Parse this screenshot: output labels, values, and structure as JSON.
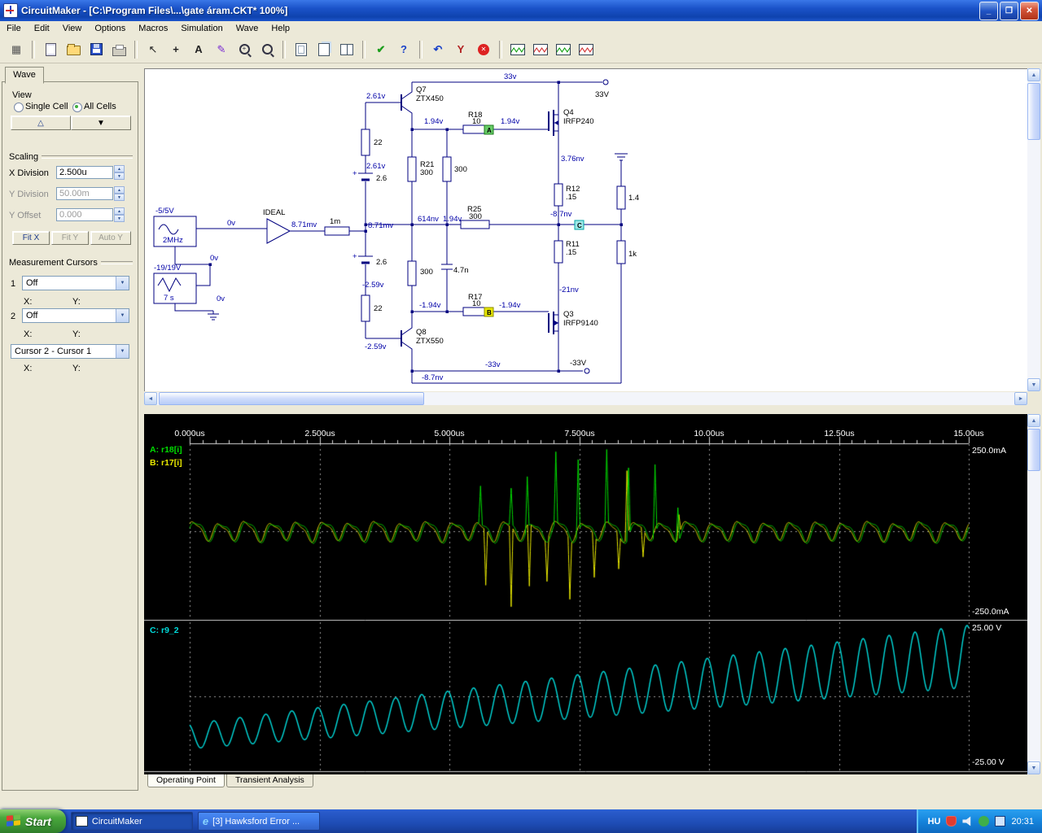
{
  "window": {
    "title": "CircuitMaker - [C:\\Program Files\\...\\gate áram.CKT* 100%]",
    "controls": {
      "minimize": "_",
      "maximize": "❐",
      "close": "✕"
    }
  },
  "menu": [
    "File",
    "Edit",
    "View",
    "Options",
    "Macros",
    "Simulation",
    "Wave",
    "Help"
  ],
  "toolbar": {
    "groups": [
      [
        "parts-browser"
      ],
      [
        "new",
        "open",
        "save",
        "print"
      ],
      [
        "select",
        "wire",
        "text",
        "probe",
        "zoom-area",
        "zoom"
      ],
      [
        "fit-page",
        "multi-page",
        "split-view"
      ],
      [
        "erc-check",
        "help"
      ],
      [
        "undo",
        "probe-y",
        "stop"
      ],
      [
        "scope-1",
        "scope-2",
        "scope-3",
        "scope-4"
      ]
    ]
  },
  "wave_panel": {
    "tab_label": "Wave",
    "view_label": "View",
    "radio_single": "Single Cell",
    "radio_all": "All Cells",
    "up_button": "△",
    "down_button": "▼",
    "scaling_label": "Scaling",
    "x_division_label": "X Division",
    "x_division_value": "2.500u",
    "y_division_label": "Y Division",
    "y_division_value": "50.00m",
    "y_offset_label": "Y Offset",
    "y_offset_value": "0.000",
    "fit_x": "Fit X",
    "fit_y": "Fit Y",
    "auto_y": "Auto Y",
    "cursors_label": "Measurement Cursors",
    "cursor1_num": "1",
    "cursor1_value": "Off",
    "cursor2_num": "2",
    "cursor2_value": "Off",
    "diff_value": "Cursor 2 - Cursor 1",
    "x_label": "X:",
    "y_label": "Y:"
  },
  "circuit": {
    "labels": {
      "rail_top": "33v",
      "term_top": "33V",
      "q7_ref": "Q7",
      "q7_part": "ZTX450",
      "v_q7_base": "2.61v",
      "r22_top": "22",
      "v_bat_top": "2.61v",
      "plus_top": "+",
      "bat_top": "2.6",
      "r21_ref": "R21",
      "r21_val": "300",
      "r300_top": "300",
      "v_r18_l": "1.94v",
      "r18_ref": "R18",
      "r18_val": "10",
      "v_r18_r": "1.94v",
      "probe_a": "A",
      "q4_ref": "Q4",
      "q4_part": "IRFP240",
      "v_q4_s": "3.76nv",
      "r12_ref": "R12",
      "r12_val": ".15",
      "r_load1": "1.4",
      "v_out": "-8.7nv",
      "probe_c": "C",
      "r25_ref": "R25",
      "r25_val": "300",
      "v_614": "614nv",
      "v_mid": "1.94v",
      "r11_ref": "R11",
      "r11_val": ".15",
      "r_load2": "1k",
      "v_q3_s": "-21nv",
      "q3_ref": "Q3",
      "q3_part": "IRFP9140",
      "term_bot": "-33V",
      "rail_bot": "-33v",
      "v_fb": "-8.7nv",
      "q8_ref": "Q8",
      "q8_part": "ZTX550",
      "v_q8_base": "-2.59v",
      "v_bat_bot": "-2.59v",
      "plus_bot": "+",
      "bat_bot": "2.6",
      "r22_bot": "22",
      "r300_bot": "300",
      "c_val": "4.7n",
      "v_r17_l": "-1.94v",
      "r17_ref": "R17",
      "r17_val": "10",
      "v_r17_r": "-1.94v",
      "probe_b": "B",
      "src1_name": "-5/5V",
      "src1_freq": "2MHz",
      "v_in1": "0v",
      "buf_name": "IDEAL",
      "v_buf": "8.71mv",
      "r1m": "1m",
      "v_r1m": "8.71mv",
      "v_in2": "0v",
      "src2_name": "-19/19V",
      "src2_time": "7 s",
      "v_in3": "0v"
    }
  },
  "bottom_tabs": [
    "Operating Point",
    "Transient Analysis"
  ],
  "taskbar": {
    "start_label": "Start",
    "tasks": [
      "CircuitMaker",
      "[3] Hawksford Error ..."
    ],
    "tray_lang": "HU",
    "clock": "20:31"
  },
  "chart_data": [
    {
      "type": "line",
      "x_unit": "us",
      "x_range": [
        0,
        15
      ],
      "x_ticks": [
        "0.000us",
        "2.500us",
        "5.000us",
        "7.500us",
        "10.00us",
        "12.50us",
        "15.00us"
      ],
      "y_range": [
        -250,
        250
      ],
      "y_top_label": "250.0mA",
      "y_bottom_label": "-250.0mA",
      "grid": "dashed",
      "legend_position": "top-left",
      "series": [
        {
          "name": "A: r18[i]",
          "color": "#00dd00",
          "kind": "ripple",
          "amp": 25,
          "period": 0.5,
          "phase": 0,
          "spikes": [
            [
              5.6,
              110
            ],
            [
              6.19,
              105
            ],
            [
              6.5,
              150
            ],
            [
              7.05,
              205
            ],
            [
              7.48,
              210
            ],
            [
              8.03,
              215
            ],
            [
              8.45,
              200
            ],
            [
              8.96,
              200
            ],
            [
              9.4,
              100
            ]
          ]
        },
        {
          "name": "B: r17[i]",
          "color": "#e8e800",
          "kind": "ripple",
          "amp": 24,
          "period": 0.5,
          "phase": 0.5,
          "spikes": [
            [
              5.7,
              -160
            ],
            [
              6.19,
              -230
            ],
            [
              6.54,
              -180
            ],
            [
              6.88,
              -120
            ],
            [
              7.32,
              -170
            ],
            [
              7.79,
              -120
            ],
            [
              8.26,
              -100
            ],
            [
              8.42,
              190
            ],
            [
              8.73,
              -80
            ],
            [
              9.42,
              60
            ]
          ]
        }
      ]
    },
    {
      "type": "line",
      "x_unit": "us",
      "x_range": [
        0,
        15
      ],
      "y_range": [
        -25,
        25
      ],
      "y_top_label": "25.00 V",
      "y_bottom_label": "-25.00 V",
      "grid": "dashed",
      "series": [
        {
          "name": "C: r9_2",
          "color": "#00dcdc",
          "kind": "sine_ramp",
          "period": 0.5,
          "phase": 2,
          "offset_start": -13.5,
          "offset_end": 13.5,
          "amp_start": 4.2,
          "amp_end": 10.5
        }
      ]
    }
  ]
}
